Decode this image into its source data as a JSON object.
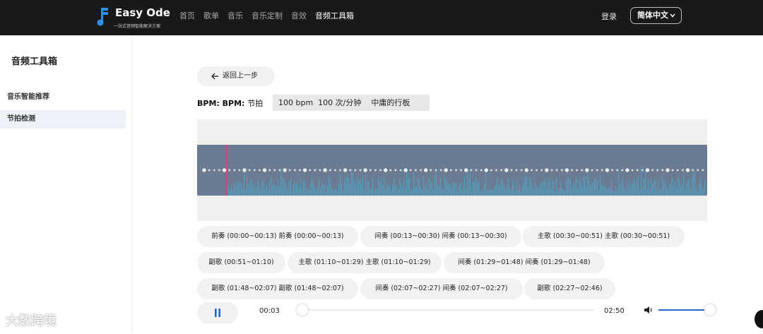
{
  "header": {
    "brand": "Easy Ode",
    "tagline": "一站式音频智能解决方案",
    "nav": [
      "首页",
      "歌单",
      "音乐",
      "音乐定制",
      "音效",
      "音频工具箱"
    ],
    "active_nav": "音频工具箱",
    "login": "登录",
    "language": "简体中文"
  },
  "sidebar": {
    "title": "音频工具箱",
    "items": [
      {
        "label": "音乐智能推荐",
        "active": false
      },
      {
        "label": "节拍检测",
        "active": true
      }
    ]
  },
  "main": {
    "back_label": "返回上一步",
    "bpm": {
      "label_a": "BPM:",
      "label_b": "BPM:",
      "label_c": "节拍",
      "value": "100 bpm  100 次/分钟    中庸的行板"
    },
    "segments": [
      {
        "label": "前奏 (00:00~00:13)  前奏  (00:00~00:13)"
      },
      {
        "label": "间奏 (00:13~00:30)  间奏  (00:13~00:30)"
      },
      {
        "label": "主歌 (00:30~00:51)  主歌  (00:30~00:51)"
      },
      {
        "label": "副歌 (00:51~01:10)"
      },
      {
        "label": "主歌 (01:10~01:29)  主歌  (01:10~01:29)"
      },
      {
        "label": "间奏 (01:29~01:48)  间奏  (01:29~01:48)"
      },
      {
        "label": "副歌 (01:48~02:07)  副歌  (01:48~02:07)"
      },
      {
        "label": "间奏 (02:07~02:27)  间奏  (02:07~02:27)"
      },
      {
        "label": "副歌 (02:27~02:46)"
      }
    ],
    "player": {
      "current": "00:03",
      "total": "02:50",
      "progress": 0.02,
      "volume": 1.0
    }
  },
  "watermark": "大数跨境",
  "colors": {
    "topbar": "#191919",
    "wave": "#6b7b92",
    "wave_bars": "#4fa3c6",
    "playhead": "#c0507a",
    "accent": "#1f6ac8"
  }
}
